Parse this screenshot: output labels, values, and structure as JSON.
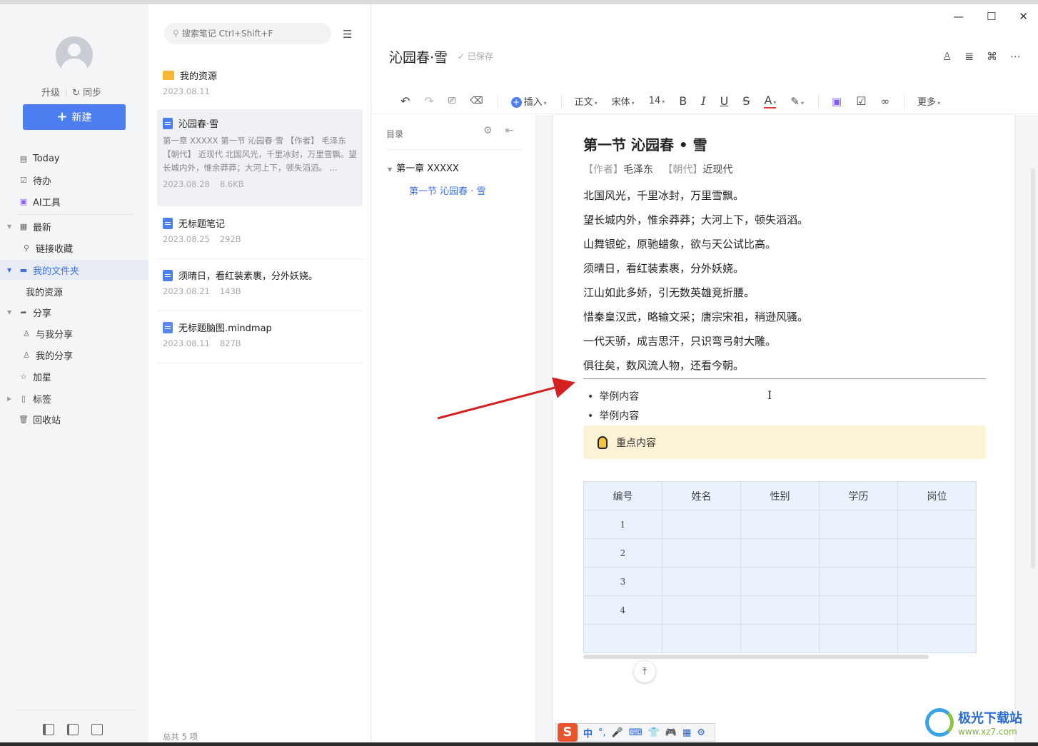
{
  "sidebar": {
    "upgrade": "升级",
    "sync": "同步",
    "new_button": "新建",
    "items": [
      {
        "label": "Today",
        "icon": "calendar-icon"
      },
      {
        "label": "待办",
        "icon": "checkbox-icon"
      },
      {
        "label": "AI工具",
        "icon": "ai-icon"
      },
      {
        "label": "最新",
        "icon": "grid-icon"
      },
      {
        "label": "链接收藏",
        "icon": "link-icon"
      },
      {
        "label": "我的文件夹",
        "icon": "folder-icon"
      },
      {
        "label": "我的资源",
        "icon": ""
      },
      {
        "label": "分享",
        "icon": "share-icon"
      },
      {
        "label": "与我分享",
        "icon": "user-icon"
      },
      {
        "label": "我的分享",
        "icon": "user-icon"
      },
      {
        "label": "加星",
        "icon": "star-icon"
      },
      {
        "label": "标签",
        "icon": "bookmark-icon"
      },
      {
        "label": "回收站",
        "icon": "trash-icon"
      }
    ]
  },
  "notelist": {
    "search_placeholder": "搜索笔记 Ctrl+Shift+F",
    "notes": [
      {
        "title": "我的资源",
        "preview": "",
        "date": "2023.08.11",
        "size": ""
      },
      {
        "title": "沁园春·雪",
        "preview": "第一章 XXXXX 第一节 沁园春·雪 【作者】 毛泽东 【朝代】 近现代 北国风光，千里冰封，万里雪飘。望长城内外，惟余莽莽；大河上下，顿失滔滔。 ...",
        "date": "2023.08.28",
        "size": "8.6KB"
      },
      {
        "title": "无标题笔记",
        "preview": "",
        "date": "2023.08.25",
        "size": "292B"
      },
      {
        "title": "须晴日，看红装素裹，分外妖娆。",
        "preview": "",
        "date": "2023.08.21",
        "size": "143B"
      },
      {
        "title": "无标题脑图.mindmap",
        "preview": "",
        "date": "2023.08.11",
        "size": "827B"
      }
    ],
    "total": "总共 5 项"
  },
  "editor": {
    "title": "沁园春·雪",
    "saved": "已保存",
    "toolbar": {
      "insert": "插入",
      "paragraph": "正文",
      "font": "宋体",
      "size": "14",
      "bold": "B",
      "italic": "I",
      "underline": "U",
      "strike": "S",
      "font_color": "A",
      "more": "更多"
    },
    "toc": {
      "header": "目录",
      "h1": "第一章  XXXXX",
      "h2": "第一节  沁园春 · 雪"
    },
    "doc": {
      "heading": "第一节  沁园春 • 雪",
      "author_label": "【作者】",
      "author": "毛泽东",
      "dynasty_label": "【朝代】",
      "dynasty": "近现代",
      "lines": [
        "北国风光，千里冰封，万里雪飘。",
        "望长城内外，惟余莽莽；大河上下，顿失滔滔。",
        "山舞银蛇，原驰蜡象，欲与天公试比高。",
        "须晴日，看红装素裹，分外妖娆。",
        "江山如此多娇，引无数英雄竞折腰。",
        "惜秦皇汉武，略输文采；唐宗宋祖，稍逊风骚。",
        "一代天骄，成吉思汗，只识弯弓射大雕。",
        "俱往矣，数风流人物，还看今朝。"
      ],
      "bullets": [
        "举例内容",
        "举例内容"
      ],
      "callout": "重点内容",
      "table": {
        "headers": [
          "编号",
          "姓名",
          "性别",
          "学历",
          "岗位"
        ],
        "rows": [
          [
            "1",
            "",
            "",
            "",
            ""
          ],
          [
            "2",
            "",
            "",
            "",
            ""
          ],
          [
            "3",
            "",
            "",
            "",
            ""
          ],
          [
            "4",
            "",
            "",
            "",
            ""
          ],
          [
            "",
            "",
            "",
            "",
            ""
          ]
        ]
      }
    }
  },
  "ime": {
    "logo": "S",
    "lang": "中"
  },
  "watermark": {
    "main": "极光下载站",
    "url": "www.xz7.com"
  },
  "colors": {
    "accent": "#4d7ef0",
    "annotation_arrow": "#d42020",
    "callout_bg": "#fcf2d6",
    "table_bg": "#eaf3fd"
  }
}
